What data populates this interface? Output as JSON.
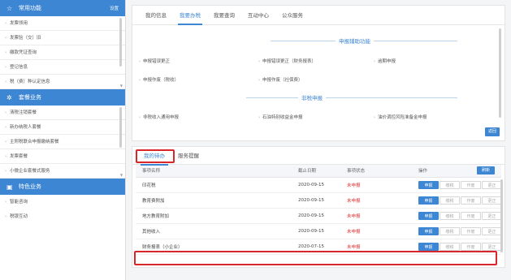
{
  "sidebar": {
    "common": {
      "title": "常用功能",
      "settings": "设置",
      "items": [
        "发票领用",
        "发票验（交）旧",
        "缴款凭证查询",
        "登记信息",
        "税（费）种认定信息"
      ]
    },
    "declare": {
      "title": "套餐业务",
      "items": [
        "清税注销套餐",
        "新办纳税人套餐",
        "主附税联合申报缴纳套餐",
        "发票套餐",
        "小微企业套餐式服务"
      ]
    },
    "special": {
      "title": "特色业务",
      "items": [
        "智能咨询",
        "税银互动"
      ]
    }
  },
  "top_tabs": [
    "我的信息",
    "我要办税",
    "我要查询",
    "互动中心",
    "公众服务"
  ],
  "top_panel": {
    "section1_title": "申报辅助功能",
    "section1_links": [
      "申报错误更正",
      "申报错误更正（财务报表）",
      "逾期申报",
      "申报作废（税收）",
      "申报作废（社保费）"
    ],
    "section2_title": "非税申报",
    "section2_links": [
      "非税收入通用申报",
      "石油特别收益金申报",
      "油价调控风险准备金申报"
    ],
    "return_label": "返回"
  },
  "bottom_panel": {
    "tabs": [
      "我的待办",
      "服务提醒"
    ],
    "headers": {
      "name": "事项名称",
      "date": "截止日期",
      "status": "事项状态",
      "op": "操作",
      "refresh": "刷新"
    },
    "op_labels": [
      "申报",
      "缴税",
      "作废",
      "更正"
    ],
    "rows": [
      {
        "name": "印花税",
        "date": "2020-09-15",
        "status": "未申报"
      },
      {
        "name": "教育费附加",
        "date": "2020-09-15",
        "status": "未申报"
      },
      {
        "name": "地方教育附加",
        "date": "2020-09-15",
        "status": "未申报"
      },
      {
        "name": "其他收入",
        "date": "2020-09-15",
        "status": "未申报"
      },
      {
        "name": "财务报表（小企业）",
        "date": "2020-07-15",
        "status": "未申报"
      }
    ]
  },
  "colors": {
    "accent": "#3d86d3",
    "highlight": "#d9262b",
    "status_pending": "#e03030"
  },
  "icons": {
    "common": "star-icon",
    "declare": "gear-icon",
    "special": "grid-icon"
  }
}
